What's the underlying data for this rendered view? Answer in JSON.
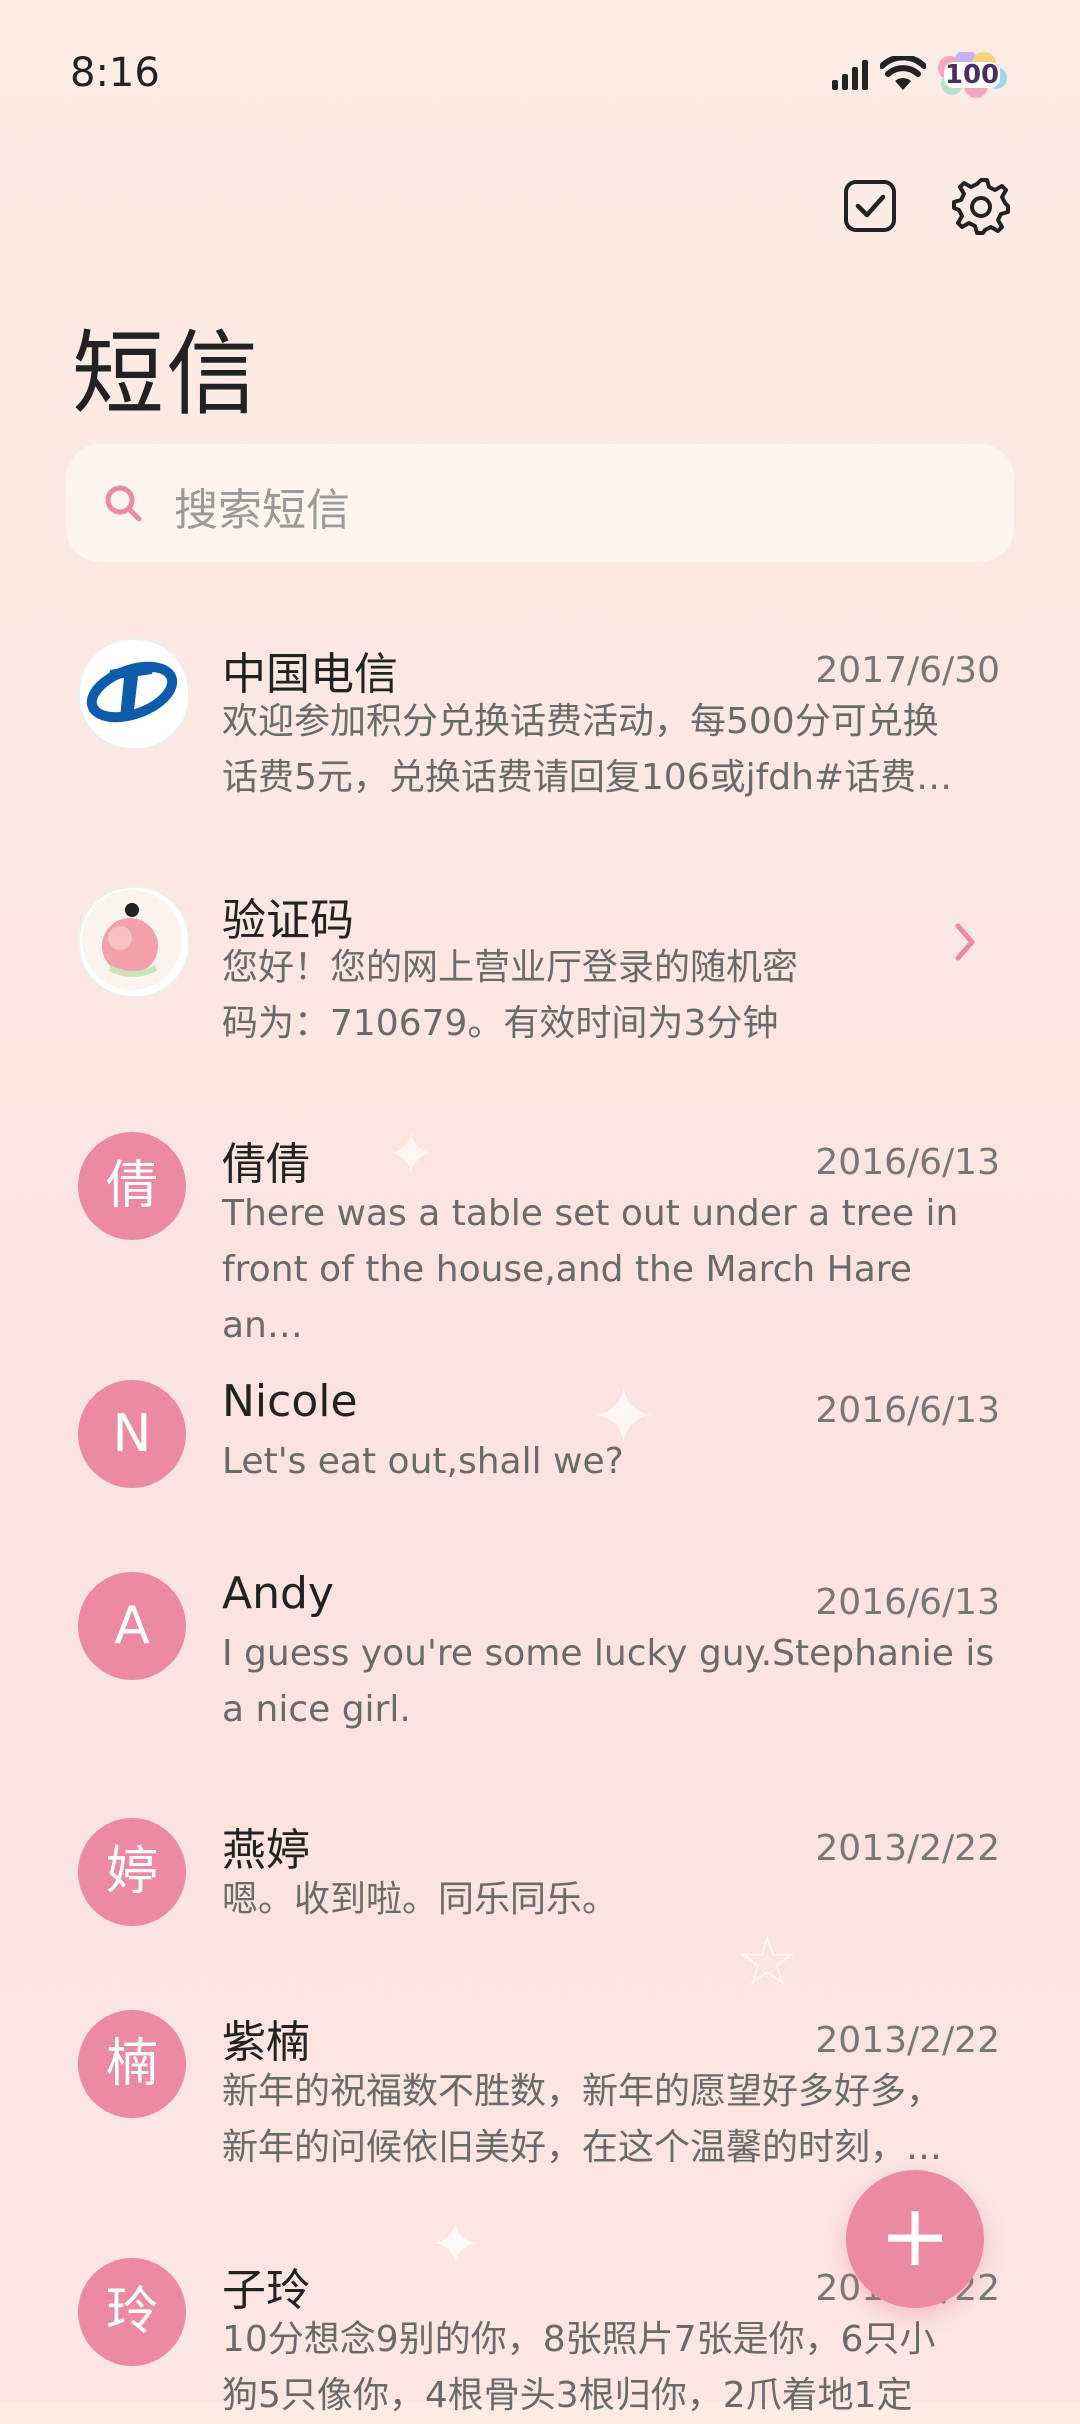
{
  "status": {
    "time": "8:16",
    "battery": "100"
  },
  "header": {
    "title": "短信"
  },
  "search": {
    "placeholder": "搜索短信"
  },
  "messages": [
    {
      "name": "中国电信",
      "date": "2017/6/30",
      "line1": "欢迎参加积分兑换话费活动，每500分可兑换",
      "line2": "话费5元，兑换话费请回复106或jfdh#话费…",
      "avatar": ""
    },
    {
      "name": "验证码",
      "date": "",
      "line1": "您好！您的网上营业厅登录的随机密",
      "line2": "码为：710679。有效时间为3分钟",
      "avatar": ""
    },
    {
      "name": "倩倩",
      "date": "2016/6/13",
      "line1": "There was a table set out under a tree in",
      "line2": "front of the house,and the March Hare an…",
      "avatar": "倩"
    },
    {
      "name": "Nicole",
      "date": "2016/6/13",
      "line1": "Let's eat out,shall we?",
      "line2": "",
      "avatar": "N"
    },
    {
      "name": "Andy",
      "date": "2016/6/13",
      "line1": "I guess you're some lucky guy.Stephanie is",
      "line2": "a nice girl.",
      "avatar": "A"
    },
    {
      "name": "燕婷",
      "date": "2013/2/22",
      "line1": "嗯。收到啦。同乐同乐。",
      "line2": "",
      "avatar": "婷"
    },
    {
      "name": "紫楠",
      "date": "2013/2/22",
      "line1": "新年的祝福数不胜数，新年的愿望好多好多，",
      "line2": "新年的问候依旧美好，在这个温馨的时刻，…",
      "avatar": "楠"
    },
    {
      "name": "子玲",
      "date": "2013/2/22",
      "line1": "10分想念9别的你，8张照片7张是你，6只小",
      "line2": "狗5只像你，4根骨头3根归你，2爪着地1定",
      "avatar": "玲"
    }
  ],
  "fab": {
    "label": "+"
  },
  "colors": {
    "accent": "#ec8aa2",
    "background": "#fbe8e2"
  }
}
